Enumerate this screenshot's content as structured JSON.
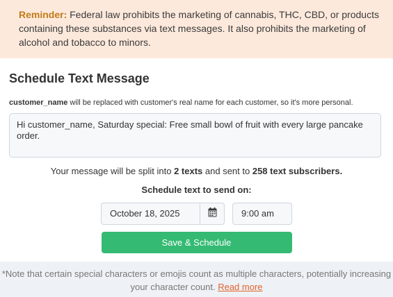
{
  "reminder": {
    "label": "Reminder:",
    "text": " Federal law prohibits the marketing of cannabis, THC, CBD, or products containing these substances via text messages. It also prohibits the marketing of alcohol and tobacco to minors."
  },
  "schedule": {
    "title": "Schedule Text Message",
    "hint_token": "customer_name",
    "hint_text": " will be replaced with customer's real name for each customer, so it's more personal.",
    "message": "Hi customer_name, Saturday special: Free small bowl of fruit with every large pancake order.",
    "split_prefix": "Your message will be split into ",
    "split_count": "2 texts",
    "split_middle": " and sent to ",
    "subscriber_count": "258 text subscribers.",
    "send_label": "Schedule text to send on:",
    "date": "October 18, 2025",
    "time": "9:00 am",
    "save_button": "Save & Schedule"
  },
  "note": {
    "text": "*Note that certain special characters or emojis count as multiple characters, potentially increasing your character count. ",
    "link": "Read more"
  },
  "colors": {
    "reminder_bg": "#fde9dc",
    "reminder_label": "#c07a17",
    "save_button": "#34ba73",
    "link": "#e2622c"
  },
  "icons": {
    "calendar": "calendar-icon"
  }
}
